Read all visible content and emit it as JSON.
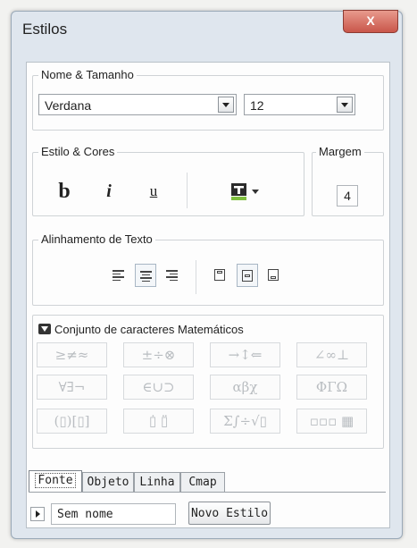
{
  "window": {
    "title": "Estilos",
    "close_label": "X"
  },
  "font_group": {
    "legend": "Nome & Tamanho",
    "font_value": "Verdana",
    "size_value": "12"
  },
  "style_group": {
    "legend": "Estilo & Cores",
    "bold_label": "b",
    "italic_label": "i",
    "underline_label": "u",
    "color_icon": "text-color-icon"
  },
  "margin_group": {
    "legend": "Margem",
    "value": "4"
  },
  "align_group": {
    "legend": "Alinhamento de Texto",
    "horizontal": [
      {
        "name": "align-left-icon",
        "active": false
      },
      {
        "name": "align-center-icon",
        "active": true
      },
      {
        "name": "align-right-icon",
        "active": false
      }
    ],
    "vertical": [
      {
        "name": "align-top-icon",
        "active": false
      },
      {
        "name": "align-middle-icon",
        "active": true
      },
      {
        "name": "align-bottom-icon",
        "active": false
      }
    ]
  },
  "math_group": {
    "header": "Conjunto de caracteres Matemáticos",
    "cells": [
      "≥≠≈",
      "±÷⊗",
      "→↕⇐",
      "∠∞⊥",
      "∀∃¬",
      "∈∪⊃",
      "αβχ",
      "ΦΓΩ",
      "(▯)[▯]",
      "▯̇ ▯̈",
      "Σ∫÷√▯",
      "▫▫▫ ▦"
    ]
  },
  "tabs": [
    {
      "label": "Fonte",
      "active": true
    },
    {
      "label": "Objeto",
      "active": false
    },
    {
      "label": "Linha",
      "active": false
    },
    {
      "label": "Cmap",
      "active": false
    }
  ],
  "bottom": {
    "style_name": "Sem nome",
    "new_style_label": "Novo Estilo"
  }
}
